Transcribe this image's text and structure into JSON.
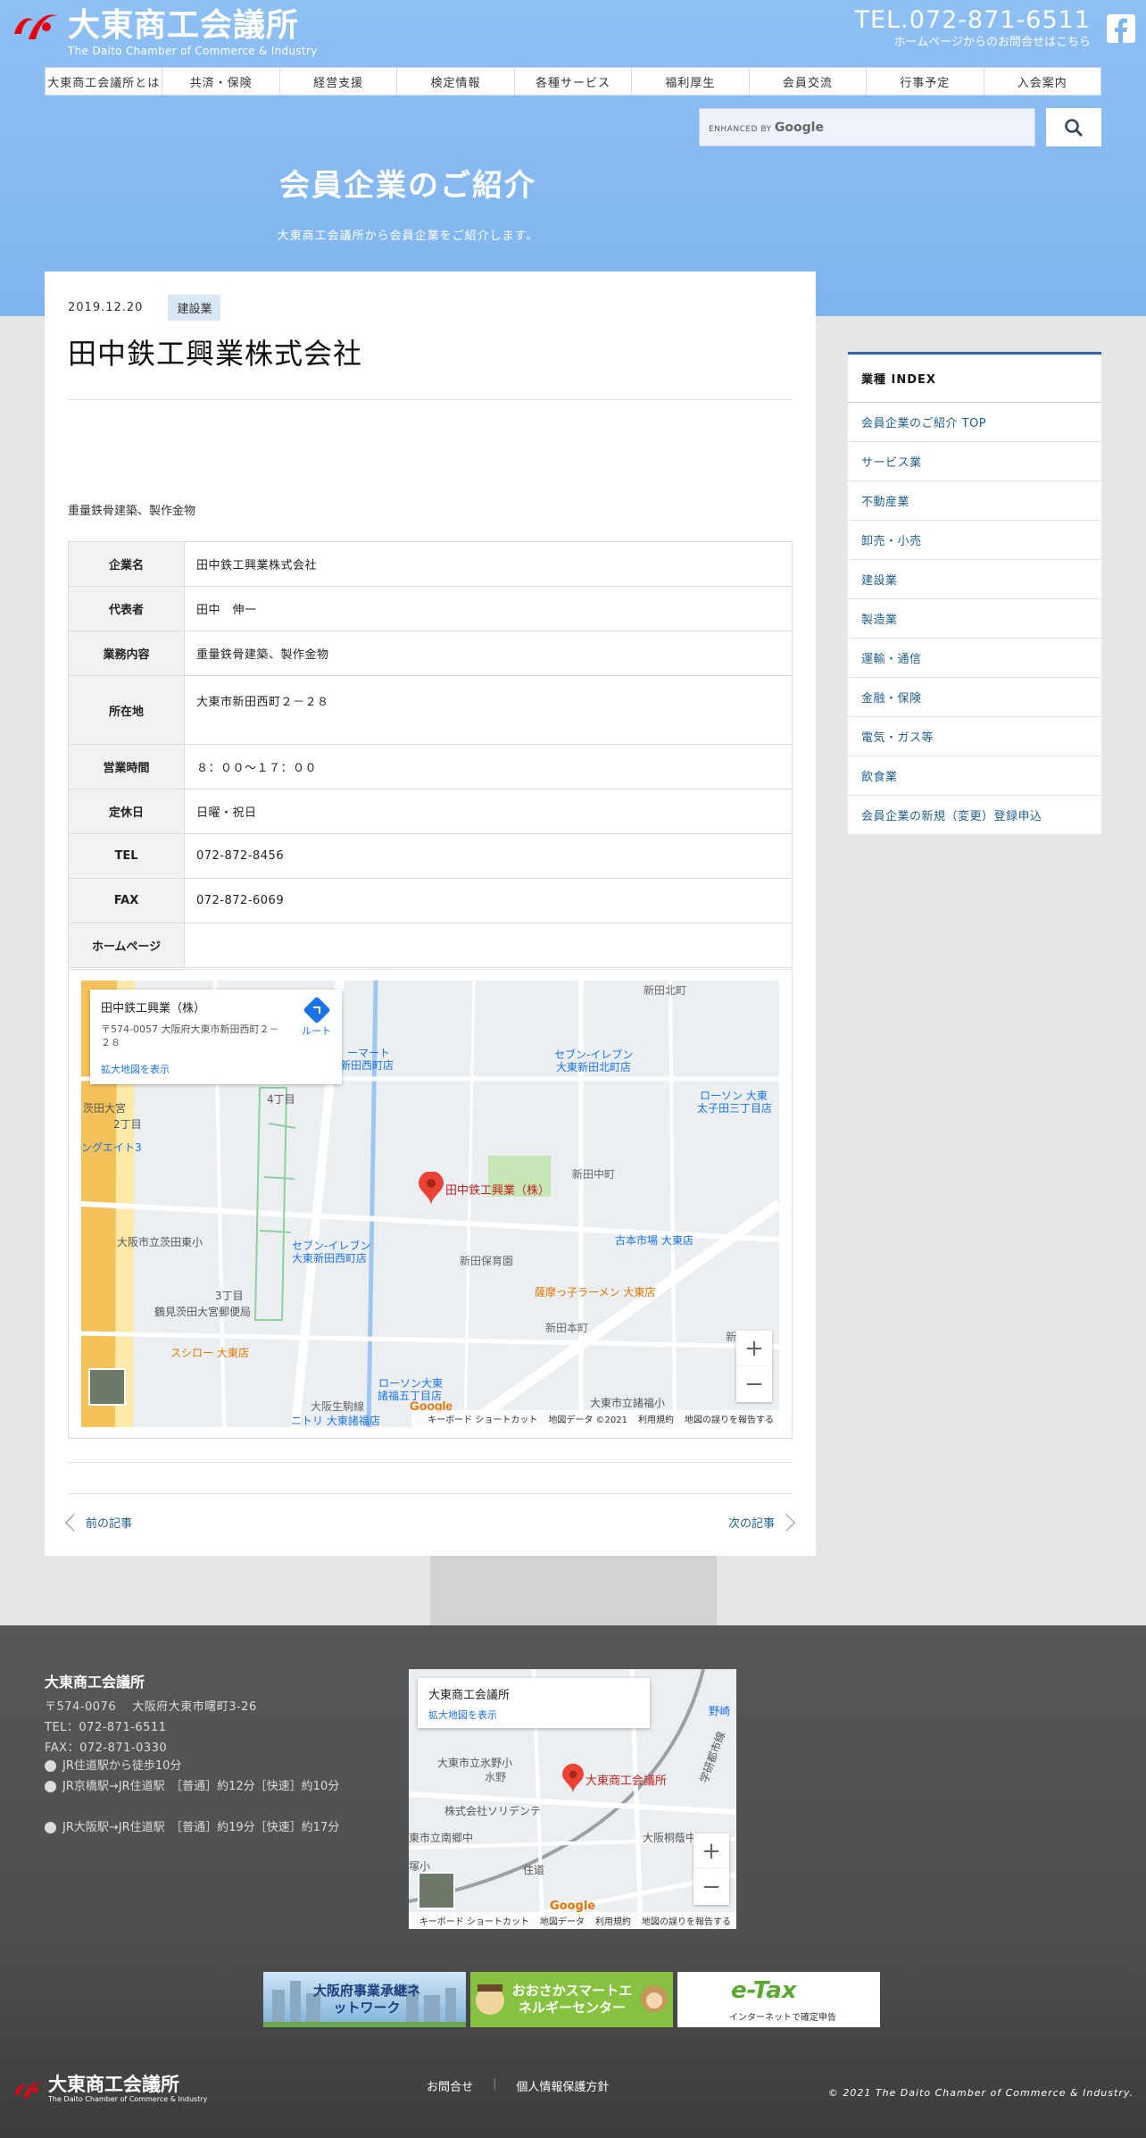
{
  "site": {
    "name": "大東商工会議所",
    "name_en": "The Daito Chamber of Commerce & Industry",
    "tel": "TEL.072-871-6511",
    "tel_note": "ホームページからのお問合せはこちら"
  },
  "nav": [
    {
      "label": "大東商工会議所とは"
    },
    {
      "label": "共済・保険"
    },
    {
      "label": "経営支援"
    },
    {
      "label": "検定情報"
    },
    {
      "label": "各種サービス"
    },
    {
      "label": "福利厚生"
    },
    {
      "label": "会員交流"
    },
    {
      "label": "行事予定"
    },
    {
      "label": "入会案内"
    }
  ],
  "search": {
    "brand_prefix": "ENHANCED BY",
    "brand": "Google"
  },
  "page": {
    "title": "会員企業のご紹介",
    "subtitle": "大東商工会議所から会員企業をご紹介します。"
  },
  "article": {
    "date": "2019.12.20",
    "category": "建設業",
    "title": "田中鉄工興業株式会社",
    "lead": "重量鉄骨建築、製作金物",
    "table": [
      {
        "label": "企業名",
        "value": "田中鉄工興業株式会社"
      },
      {
        "label": "代表者",
        "value": "田中　伸一"
      },
      {
        "label": "業務内容",
        "value": "重量鉄骨建築、製作金物"
      },
      {
        "label": "所在地",
        "value": "大東市新田西町２－２８"
      },
      {
        "label": "営業時間",
        "value": "８：００～１７：００"
      },
      {
        "label": "定休日",
        "value": "日曜・祝日"
      },
      {
        "label": "TEL",
        "value": "072-872-8456"
      },
      {
        "label": "FAX",
        "value": "072-872-6069"
      },
      {
        "label": "ホームページ",
        "value": ""
      }
    ],
    "map": {
      "card_name": "田中鉄工興業（株）",
      "card_addr": "〒574-0057 大阪府大東市新田西町２－２８",
      "card_link": "拡大地図を表示",
      "route": "ルート",
      "pin_label": "田中鉄工興業（株）",
      "labels": [
        "新田北町",
        "セブン-イレブン",
        "大東新田北町店",
        "ローソン 大東",
        "太子田三丁目店",
        "新田中町",
        "古本市場 大東店",
        "新田保育園",
        "大阪市立茨田東小",
        "セブン-イレブン",
        "大東新田西町店",
        "薩摩っ子ラーメン 大東店",
        "新田本町",
        "鶴見茨田大宮郵便局",
        "スシロー 大東店",
        "ローソン大東",
        "諸福五丁目店",
        "大東市立諸福小",
        "大阪生駒線",
        "ニトリ 大東諸福店",
        "3丁目",
        "4丁目",
        "2丁目",
        "新田東",
        "茨田大宮",
        "ーマート",
        "新田西町店",
        "ングエイト3"
      ],
      "zoom_in": "+",
      "zoom_out": "−",
      "google": "Google",
      "attrib": [
        "キーボード ショートカット",
        "地図データ ©2021",
        "利用規約",
        "地図の誤りを報告する"
      ]
    },
    "prev": "前の記事",
    "next": "次の記事"
  },
  "sidebar": {
    "head": "業種 INDEX",
    "items": [
      {
        "label": "会員企業のご紹介 TOP"
      },
      {
        "label": "サービス業"
      },
      {
        "label": "不動産業"
      },
      {
        "label": "卸売・小売"
      },
      {
        "label": "建設業"
      },
      {
        "label": "製造業"
      },
      {
        "label": "運輸・通信"
      },
      {
        "label": "金融・保険"
      },
      {
        "label": "電気・ガス等"
      },
      {
        "label": "飲食業"
      },
      {
        "label": "会員企業の新規（変更）登録申込"
      }
    ]
  },
  "footer": {
    "name": "大東商工会議所",
    "address": "〒574-0076　 大阪府大東市曙町3-26",
    "tel": "TEL：072-871-6511",
    "fax": "FAX：072-871-0330",
    "access": [
      "JR住道駅から徒歩10分",
      "JR京橋駅→JR住道駅　［普通］約12分［快速］約10分",
      "JR大阪駅→JR住道駅　［普通］約19分［快速］約17分"
    ],
    "map": {
      "card_name": "大東商工会議所",
      "card_link": "拡大地図を表示",
      "pin_label": "大東商工会議所",
      "labels": [
        "大東市立氷野小",
        "水野",
        "株式会社ソリデンテ",
        "大阪桐蔭中",
        "東市立南郷中",
        "住道",
        "塚小",
        "野崎",
        "学研都市線"
      ],
      "attrib": [
        "キーボード ショートカット",
        "地図データ",
        "利用規約",
        "地図の誤りを報告する"
      ]
    },
    "banners": [
      {
        "label": "大阪府事業承継ネットワーク"
      },
      {
        "label": "おおさかスマートエネルギーセンター"
      },
      {
        "label": "e-Tax",
        "sub": "インターネットで確定申告"
      }
    ],
    "links": [
      "お問合せ",
      "個人情報保護方針"
    ],
    "copyright": "© 2021 The Daito Chamber of Commerce & Industry."
  }
}
